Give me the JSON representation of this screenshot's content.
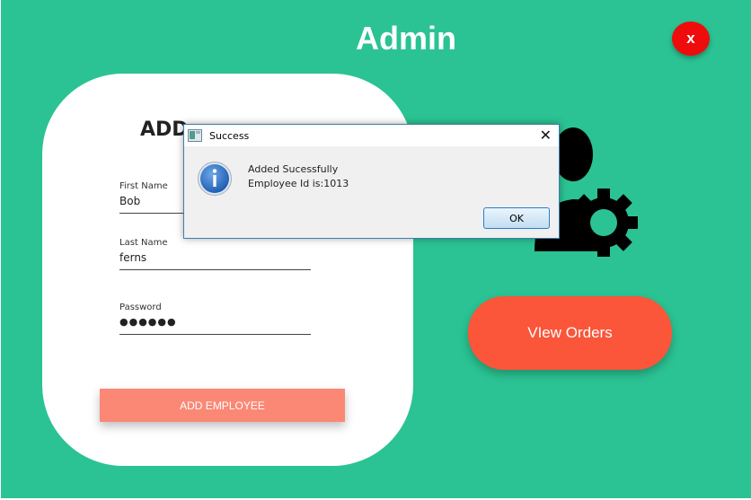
{
  "window": {
    "title": "Admin",
    "close_label": "x"
  },
  "form": {
    "title": "ADD",
    "first_name": {
      "label": "First Name",
      "value": "Bob"
    },
    "last_name": {
      "label": "Last Name",
      "value": "ferns"
    },
    "password": {
      "label": "Password",
      "value": "●●●●●●"
    },
    "submit_label": "ADD EMPLOYEE"
  },
  "actions": {
    "view_orders_label": "VIew Orders"
  },
  "dialog": {
    "title": "Success",
    "close_glyph": "✕",
    "message_line1": "Added Sucessfully",
    "message_line2": "Employee Id is:1013",
    "ok_label": "OK",
    "icon": "info-icon"
  },
  "colors": {
    "background": "#2bc393",
    "close_button": "#ee0c0c",
    "add_button": "#fb8875",
    "view_orders_button": "#fb553a",
    "dialog_border": "#3c7fb1"
  }
}
